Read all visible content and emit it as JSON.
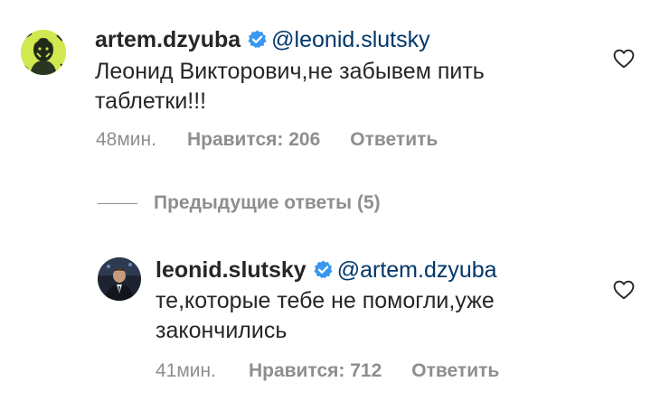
{
  "colors": {
    "text": "#262626",
    "mention": "#00376b",
    "meta": "#8e8e8e",
    "verified": "#3897f0"
  },
  "comments": [
    {
      "username": "artem.dzyuba",
      "verified": true,
      "mention": "@leonid.slutsky",
      "text_lines": [
        "Леонид Викторович,не забывем пить",
        "таблетки!!!"
      ],
      "time": "48мин.",
      "likes": "Нравится: 206",
      "reply": "Ответить",
      "icons": {
        "like": "heart-outline-icon",
        "badge": "verified-badge-icon"
      }
    },
    {
      "username": "leonid.slutsky",
      "verified": true,
      "mention": "@artem.dzyuba",
      "text_lines": [
        "те,которые тебе не помогли,уже",
        "закончились"
      ],
      "time": "41мин.",
      "likes": "Нравится: 712",
      "reply": "Ответить",
      "icons": {
        "like": "heart-outline-icon",
        "badge": "verified-badge-icon"
      }
    }
  ],
  "previous_replies": {
    "label": "Предыдущие ответы (5)"
  }
}
